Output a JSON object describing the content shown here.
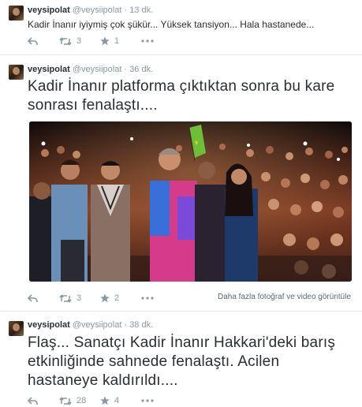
{
  "tweets": [
    {
      "username": "veysipolat",
      "handle": "@veysiipolat",
      "time": "· 13 dk.",
      "text": "Kadir İnanır iyiymiş çok şükür... Yüksek tansiyon... Hala hastanede...",
      "retweets": "3",
      "favorites": "1"
    },
    {
      "username": "veysipolat",
      "handle": "@veysiipolat",
      "time": "· 36 dk.",
      "text": "Kadir İnanır platforma çıktıktan sonra bu kare sonrası fenalaştı....",
      "retweets": "3",
      "favorites": "2",
      "media_link": "Daha fazla fotoğraf ve video görüntüle"
    },
    {
      "username": "veysipolat",
      "handle": "@veysiipolat",
      "time": "· 38 dk.",
      "text": "Flaş... Sanatçı Kadir İnanır Hakkari'deki barış etkinliğinde sahnede fenalaştı. Acilen hastaneye kaldırıldı....",
      "retweets": "28",
      "favorites": "4"
    }
  ],
  "colors": {
    "text": "#292f33",
    "meta": "#8899a6",
    "border": "#e1e8ed",
    "flag": "#6dbf3a"
  },
  "icons": [
    "reply-icon",
    "retweet-icon",
    "favorite-star-icon",
    "more-dots-icon"
  ]
}
